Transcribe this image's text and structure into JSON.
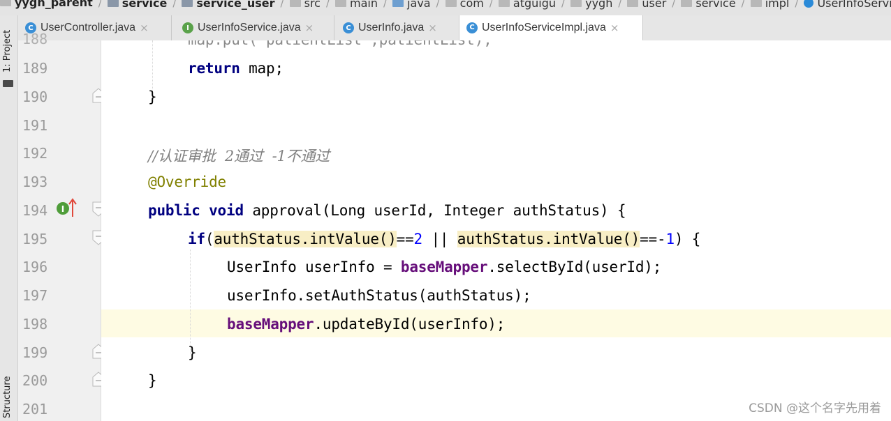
{
  "breadcrumb": [
    {
      "label": "yygh_parent",
      "icon": "folder-icon",
      "bold": true
    },
    {
      "label": "service",
      "icon": "module-icon",
      "bold": true
    },
    {
      "label": "service_user",
      "icon": "module-icon",
      "bold": true
    },
    {
      "label": "src",
      "icon": "folder-icon",
      "bold": false
    },
    {
      "label": "main",
      "icon": "folder-icon",
      "bold": false
    },
    {
      "label": "java",
      "icon": "source-folder-icon",
      "bold": false
    },
    {
      "label": "com",
      "icon": "package-icon",
      "bold": false
    },
    {
      "label": "atguigu",
      "icon": "package-icon",
      "bold": false
    },
    {
      "label": "yygh",
      "icon": "package-icon",
      "bold": false
    },
    {
      "label": "user",
      "icon": "package-icon",
      "bold": false
    },
    {
      "label": "service",
      "icon": "package-icon",
      "bold": false
    },
    {
      "label": "impl",
      "icon": "package-icon",
      "bold": false
    },
    {
      "label": "UserInfoServiceImpl",
      "icon": "class-icon",
      "bold": false
    }
  ],
  "tabs": [
    {
      "label": "UserController.java",
      "icon": "class-icon",
      "icon_letter": "C",
      "active": false
    },
    {
      "label": "UserInfoService.java",
      "icon": "interface-icon",
      "icon_letter": "I",
      "active": false
    },
    {
      "label": "UserInfo.java",
      "icon": "class-icon",
      "icon_letter": "C",
      "active": false
    },
    {
      "label": "UserInfoServiceImpl.java",
      "icon": "class-icon",
      "icon_letter": "C",
      "active": true
    }
  ],
  "toolwindows": {
    "project": "1: Project",
    "structure": "Structure"
  },
  "editor": {
    "top_partial_line": "map.put(\"patientList\",patientList);",
    "lines": [
      {
        "number": "189",
        "text": "return map;"
      },
      {
        "number": "190",
        "text": "}"
      },
      {
        "number": "191",
        "text": ""
      },
      {
        "number": "192",
        "text": "//认证审批  2通过  -1不通过"
      },
      {
        "number": "193",
        "text": "@Override"
      },
      {
        "number": "194",
        "text": "public void approval(Long userId, Integer authStatus) {"
      },
      {
        "number": "195",
        "text": "if(authStatus.intValue()==2 || authStatus.intValue()==-1) {"
      },
      {
        "number": "196",
        "text": "UserInfo userInfo = baseMapper.selectById(userId);"
      },
      {
        "number": "197",
        "text": "userInfo.setAuthStatus(authStatus);"
      },
      {
        "number": "198",
        "text": "baseMapper.updateById(userInfo);"
      },
      {
        "number": "199",
        "text": "}"
      },
      {
        "number": "200",
        "text": "}"
      },
      {
        "number": "201",
        "text": ""
      }
    ],
    "current_line": "198"
  },
  "tokens": {
    "return": "return",
    "map_semi": " map;",
    "brace_close": "}",
    "comment": "//认证审批  2通过  -1不通过",
    "override": "@Override",
    "public": "public",
    "void": " void",
    "approval_sig": " approval(Long userId, Integer authStatus) {",
    "if": "if",
    "paren_open": "(",
    "auth_intvalue": "authStatus.intValue()",
    "eq2": "==",
    "two": "2",
    "or": " || ",
    "eqm1": "==-",
    "one": "1",
    "paren_close_brace": ") {",
    "userinfo_decl": "UserInfo userInfo = ",
    "basemapper": "baseMapper",
    "select_by_id": ".selectById(userId);",
    "set_auth": "userInfo.setAuthStatus(authStatus);",
    "update_by_id": ".updateById(userInfo);"
  },
  "gutter_icons": {
    "implements_marker": "implements-method-icon",
    "override_arrow": "overrides-arrow-icon",
    "intention_bulb": "intention-bulb-icon"
  },
  "watermark": "CSDN @这个名字先用着",
  "colors": {
    "keyword": "#000080",
    "comment": "#808080",
    "annotation": "#808000",
    "field": "#660e7a",
    "number": "#0000ff",
    "current_line": "#fefbe3",
    "usage_highlight": "#f8eec5"
  }
}
